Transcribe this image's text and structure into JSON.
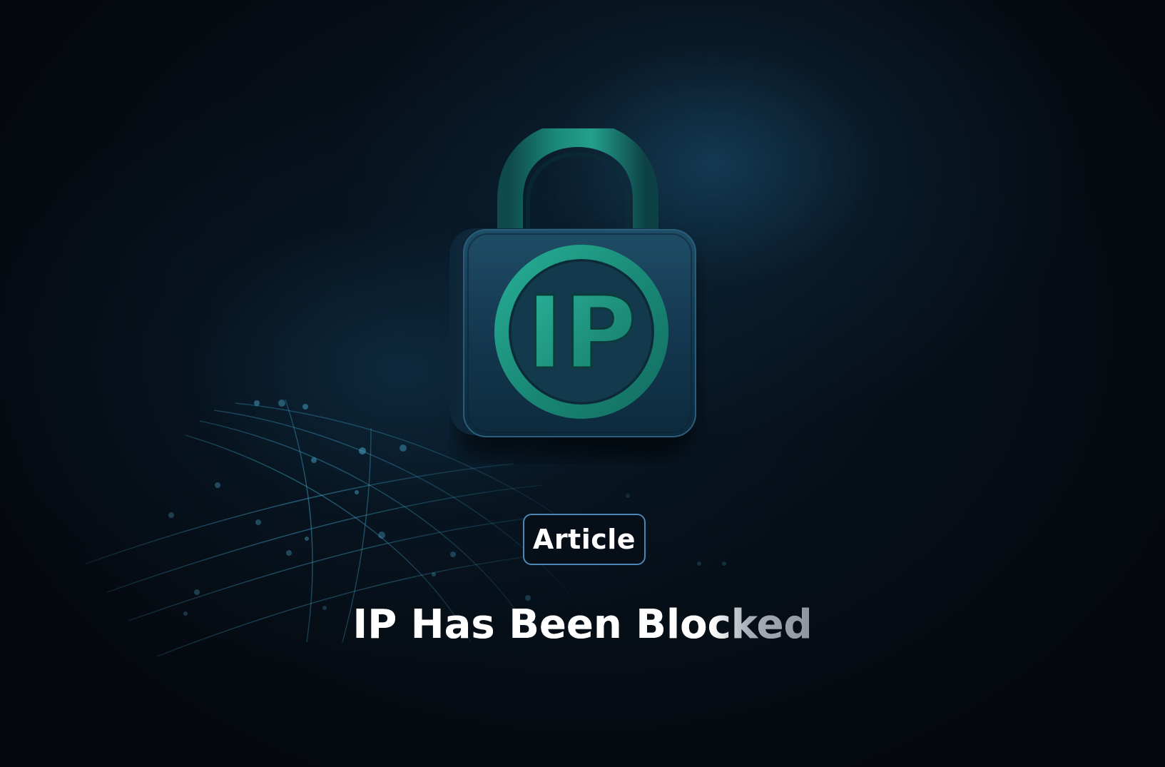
{
  "badge": {
    "label": "Article"
  },
  "headline": {
    "text": "IP Has Been Blocked"
  },
  "lock": {
    "emblem_text": "IP"
  },
  "colors": {
    "background": "#05090f",
    "accent_teal": "#1f9a86",
    "lock_body": "#163a4e",
    "badge_border": "#4d86b5",
    "text": "#ffffff"
  },
  "icons": {
    "hero": "padlock-icon",
    "backdrop": "network-globe-graphic"
  }
}
